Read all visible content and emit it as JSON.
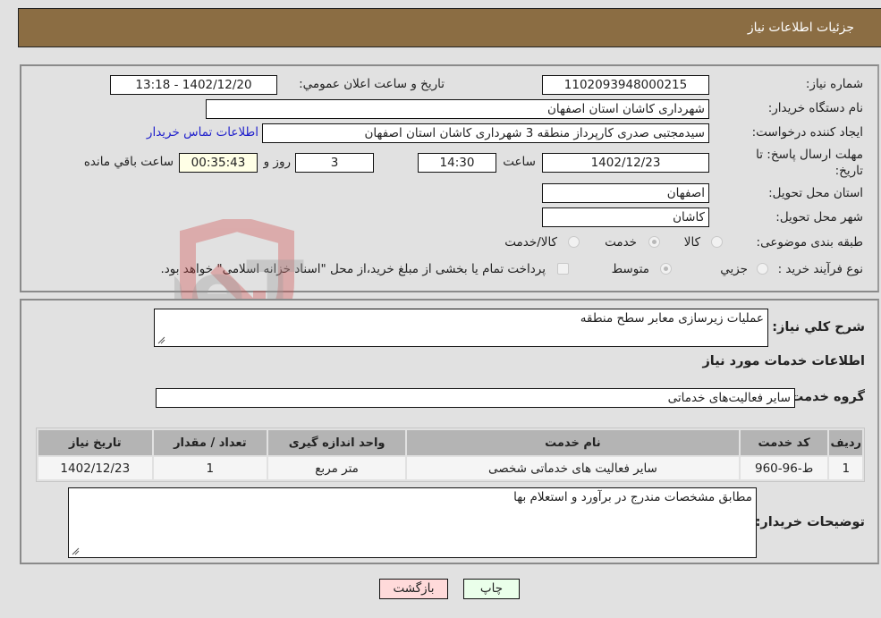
{
  "header": {
    "title": "جزئیات اطلاعات نیاز"
  },
  "details": {
    "need_number": {
      "label": "شماره نیاز:",
      "value": "1102093948000215"
    },
    "announce_datetime": {
      "label": "تاریخ و ساعت اعلان عمومي:",
      "value": "1402/12/20 - 13:18"
    },
    "buyer_org": {
      "label": "نام دستگاه خریدار:",
      "value": "شهرداری کاشان استان اصفهان"
    },
    "requester": {
      "label": "ایجاد کننده درخواست:",
      "value": "سیدمجتبی صدری کارپرداز منطقه 3 شهرداری کاشان استان اصفهان"
    },
    "contact_link": "اطلاعات تماس خریدار",
    "deadline": {
      "label": "مهلت ارسال پاسخ: تا تاریخ:",
      "date": "1402/12/23",
      "time_label": "ساعت",
      "time": "14:30",
      "days": "3",
      "days_label": "روز و",
      "remaining": "00:35:43",
      "remaining_label": "ساعت باقي مانده"
    },
    "province": {
      "label": "استان محل تحویل:",
      "value": "اصفهان"
    },
    "city": {
      "label": "شهر محل تحویل:",
      "value": "کاشان"
    },
    "category": {
      "label": "طبقه بندی موضوعی:",
      "options": [
        {
          "label": "کالا",
          "checked": false
        },
        {
          "label": "خدمت",
          "checked": true
        },
        {
          "label": "کالا/خدمت",
          "checked": false
        }
      ]
    },
    "purchase_type": {
      "label": "نوع فرآیند خرید :",
      "options": [
        {
          "label": "جزيي",
          "checked": false
        },
        {
          "label": "متوسط",
          "checked": true
        }
      ],
      "treasury_note": "پرداخت تمام یا بخشی از مبلغ خرید،از محل \"اسناد خزانه اسلامی\" خواهد بود.",
      "treasury_checked": false
    }
  },
  "summary": {
    "description_label": "شرح کلي نیاز:",
    "description": "عملیات زیرسازی معابر سطح منطقه",
    "services_title": "اطلاعات خدمات مورد نیاز",
    "service_group_label": "گروه خدمت:",
    "service_group": "سایر فعالیت‌های خدماتی"
  },
  "table": {
    "headers": [
      "ردیف",
      "کد خدمت",
      "نام خدمت",
      "واحد اندازه گیری",
      "تعداد / مقدار",
      "تاریخ نیاز"
    ],
    "rows": [
      [
        "1",
        "ط-96-960",
        "سایر فعالیت های خدماتی شخصی",
        "متر مربع",
        "1",
        "1402/12/23"
      ]
    ]
  },
  "buyer_notes": {
    "label": "توضیحات خریدار:",
    "value": "مطابق مشخصات مندرج در برآورد و استعلام بها"
  },
  "buttons": {
    "print": "چاپ",
    "back": "بازگشت"
  },
  "watermark": "AriaTender.neT"
}
